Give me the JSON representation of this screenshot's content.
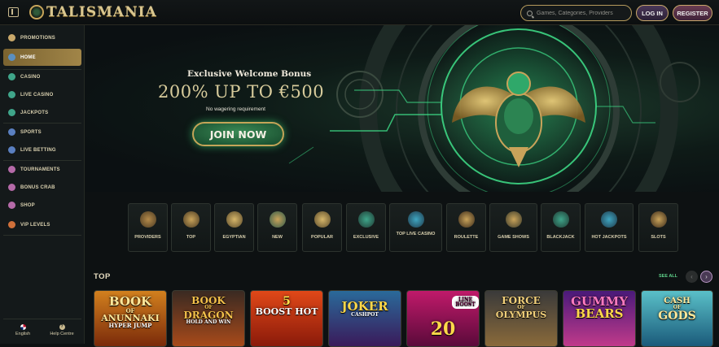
{
  "header": {
    "brand": "TALISMANIA",
    "search_placeholder": "Games, Categories, Providers",
    "login_label": "LOG IN",
    "register_label": "REGISTER"
  },
  "sidebar": {
    "items": [
      {
        "label": "PROMOTIONS",
        "icon": "gift-icon",
        "color": "#c9a86a"
      },
      {
        "label": "HOME",
        "icon": "home-icon",
        "color": "#5a8fc0"
      },
      {
        "label": "CASINO",
        "icon": "casino-icon",
        "color": "#3fa58a"
      },
      {
        "label": "LIVE CASINO",
        "icon": "live-casino-icon",
        "color": "#3fa58a"
      },
      {
        "label": "JACKPOTS",
        "icon": "jackpot-icon",
        "color": "#3fa58a"
      },
      {
        "label": "SPORTS",
        "icon": "sports-icon",
        "color": "#5a7fc0"
      },
      {
        "label": "LIVE BETTING",
        "icon": "live-betting-icon",
        "color": "#5a7fc0"
      },
      {
        "label": "TOURNAMENTS",
        "icon": "trophy-icon",
        "color": "#b56aa8"
      },
      {
        "label": "BONUS CRAB",
        "icon": "crab-icon",
        "color": "#b56aa8"
      },
      {
        "label": "SHOP",
        "icon": "shop-icon",
        "color": "#b56aa8"
      },
      {
        "label": "VIP LEVELS",
        "icon": "vip-icon",
        "color": "#d0703a"
      }
    ],
    "language_label": "English",
    "help_label": "Help Centre"
  },
  "hero": {
    "welcome": "Exclusive Welcome Bonus",
    "bonus": "200% UP TO €500",
    "note": "No wagering requirement",
    "cta": "JOIN NOW"
  },
  "categories": [
    {
      "label": "PROVIDERS",
      "icon": "providers-icon"
    },
    {
      "label": "TOP",
      "icon": "top-icon"
    },
    {
      "label": "EGYPTIAN",
      "icon": "eye-of-horus-icon"
    },
    {
      "label": "NEW",
      "icon": "new-icon"
    },
    {
      "label": "POPULAR",
      "icon": "popular-icon"
    },
    {
      "label": "EXCLUSIVE",
      "icon": "exclusive-icon"
    },
    {
      "label": "TOP LIVE CASINO",
      "icon": "live-casino-icon"
    },
    {
      "label": "ROULETTE",
      "icon": "roulette-icon"
    },
    {
      "label": "GAME SHOWS",
      "icon": "game-shows-icon"
    },
    {
      "label": "BLACKJACK",
      "icon": "blackjack-icon"
    },
    {
      "label": "HOT JACKPOTS",
      "icon": "hot-jackpots-icon"
    },
    {
      "label": "SLOTS",
      "icon": "slots-icon"
    }
  ],
  "top_section": {
    "title": "TOP",
    "see_all": "SEE ALL",
    "games": [
      {
        "title": "BOOK OF ANUNNAKI HYPER JUMP",
        "line1": "BOOK",
        "line2": "OF",
        "line3": "ANUNNAKI",
        "line4": "HYPER JUMP"
      },
      {
        "title": "BOOK OF DRAGON HOLD AND WIN",
        "line1": "BOOK",
        "line2": "OF",
        "line3": "DRAGON",
        "line4": "HOLD AND WIN"
      },
      {
        "title": "5 BOOST HOT",
        "line1": "5",
        "line2": "",
        "line3": "BOOST HOT",
        "line4": ""
      },
      {
        "title": "JOKER CASHPOT",
        "line1": "",
        "line2": "",
        "line3": "JOKER",
        "line4": "CASHPOT"
      },
      {
        "title": "20 LINE BOOST",
        "line1": "LINE BOOST",
        "line2": "",
        "line3": "20",
        "line4": ""
      },
      {
        "title": "FORCE OF OLYMPUS",
        "line1": "FORCE",
        "line2": "OF",
        "line3": "OLYMPUS",
        "line4": ""
      },
      {
        "title": "GUMMY BEARS",
        "line1": "GUMMY",
        "line2": "",
        "line3": "BEARS",
        "line4": ""
      },
      {
        "title": "CASH OF GODS",
        "line1": "CASH",
        "line2": "OF",
        "line3": "GODS",
        "line4": ""
      }
    ]
  }
}
